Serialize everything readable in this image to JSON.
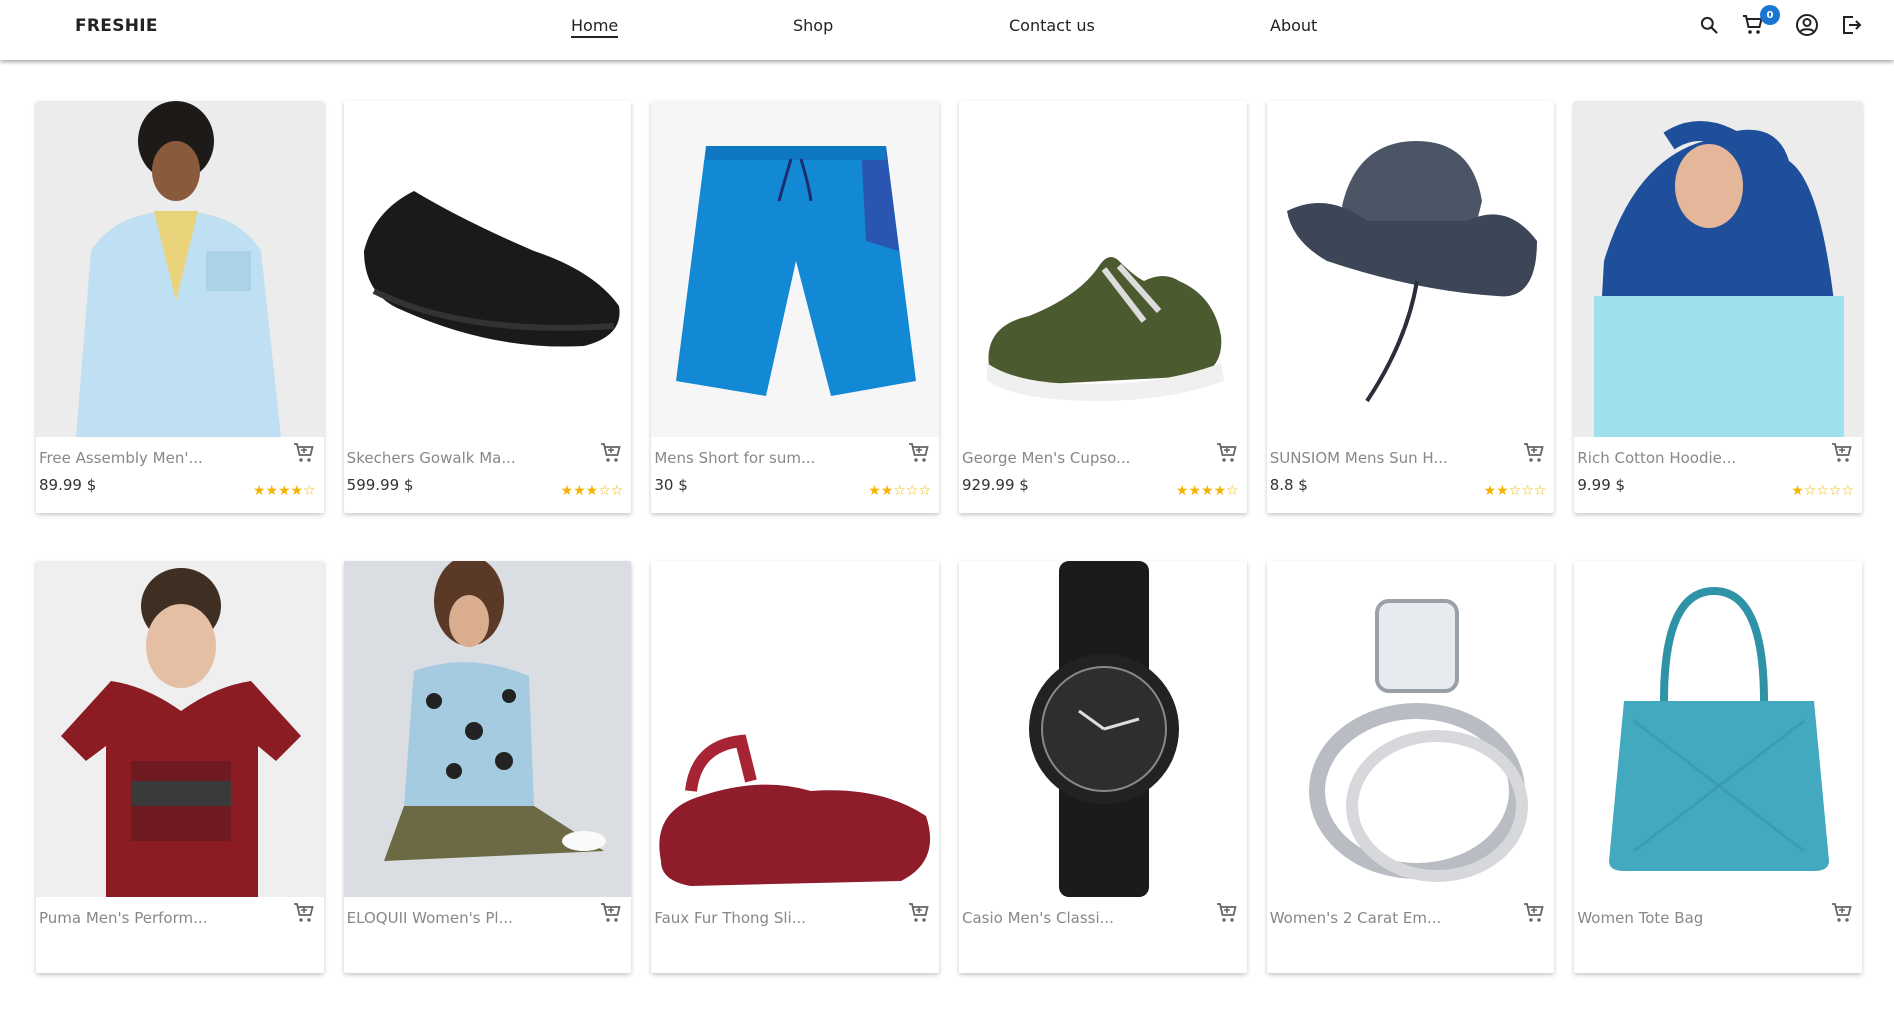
{
  "brand": "FRESHIE",
  "nav": {
    "links": [
      "Home",
      "Shop",
      "Contact us",
      "About"
    ],
    "cart_count": "0"
  },
  "products": [
    {
      "title": "Free Assembly Men'...",
      "price": "89.99 $",
      "rating": 4,
      "image": "light-blue-jacket"
    },
    {
      "title": "Skechers Gowalk Ma...",
      "price": "599.99 $",
      "rating": 3,
      "image": "black-slip-on-shoe"
    },
    {
      "title": "Mens Short for sum...",
      "price": "30 $",
      "rating": 2,
      "image": "blue-shorts"
    },
    {
      "title": "George Men's Cupso...",
      "price": "929.99 $",
      "rating": 4,
      "image": "green-sneaker"
    },
    {
      "title": "SUNSIOM Mens Sun H...",
      "price": "8.8 $",
      "rating": 2,
      "image": "navy-bucket-hat"
    },
    {
      "title": "Rich Cotton Hoodie...",
      "price": "9.99 $",
      "rating": 1,
      "image": "navy-light-blue-hoodie"
    },
    {
      "title": "Puma Men's Perform...",
      "price": "",
      "rating": 0,
      "image": "red-tshirt"
    },
    {
      "title": "ELOQUII Women's Pl...",
      "price": "",
      "rating": 0,
      "image": "leopard-sweater"
    },
    {
      "title": "Faux Fur Thong Sli...",
      "price": "",
      "rating": 0,
      "image": "red-fur-slipper"
    },
    {
      "title": "Casio Men's Classi...",
      "price": "",
      "rating": 0,
      "image": "black-watch"
    },
    {
      "title": "Women's 2 Carat Em...",
      "price": "",
      "rating": 0,
      "image": "diamond-ring"
    },
    {
      "title": "Women Tote Bag",
      "price": "",
      "rating": 0,
      "image": "teal-tote-bag"
    }
  ],
  "colors": {
    "accent": "#1976d2",
    "star": "#f5b301"
  }
}
